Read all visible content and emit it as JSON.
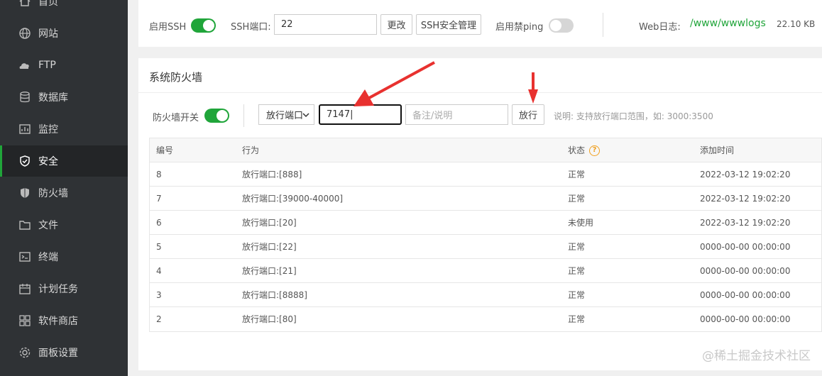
{
  "sidebar": {
    "items": [
      {
        "label": "首页",
        "icon": "home-icon"
      },
      {
        "label": "网站",
        "icon": "globe-icon"
      },
      {
        "label": "FTP",
        "icon": "ftp-icon"
      },
      {
        "label": "数据库",
        "icon": "database-icon"
      },
      {
        "label": "监控",
        "icon": "monitor-icon"
      },
      {
        "label": "安全",
        "icon": "shield-check-icon",
        "active": true
      },
      {
        "label": "防火墙",
        "icon": "shield-icon"
      },
      {
        "label": "文件",
        "icon": "folder-icon"
      },
      {
        "label": "终端",
        "icon": "terminal-icon"
      },
      {
        "label": "计划任务",
        "icon": "calendar-icon"
      },
      {
        "label": "软件商店",
        "icon": "grid-icon"
      },
      {
        "label": "面板设置",
        "icon": "gear-icon"
      }
    ]
  },
  "ssh": {
    "enable_label": "启用SSH",
    "enabled": true,
    "port_label": "SSH端口:",
    "port_value": "22",
    "change_button": "更改",
    "manage_button": "SSH安全管理",
    "ping_label": "启用禁ping",
    "ping_enabled": false,
    "weblog_label": "Web日志:",
    "weblog_path": "/www/wwwlogs",
    "weblog_size": "22.10 KB"
  },
  "firewall": {
    "title": "系统防火墙",
    "switch_label": "防火墙开关",
    "switch_on": true,
    "type_select": "放行端口",
    "port_input": "7147",
    "remark_placeholder": "备注/说明",
    "allow_button": "放行",
    "hint": "说明: 支持放行端口范围，如: 3000:3500",
    "columns": [
      "编号",
      "行为",
      "状态",
      "添加时间"
    ],
    "rows": [
      {
        "id": "8",
        "action": "放行端口:[888]",
        "status": "正常",
        "time": "2022-03-12 19:02:20"
      },
      {
        "id": "7",
        "action": "放行端口:[39000-40000]",
        "status": "正常",
        "time": "2022-03-12 19:02:20"
      },
      {
        "id": "6",
        "action": "放行端口:[20]",
        "status": "未使用",
        "time": "2022-03-12 19:02:20"
      },
      {
        "id": "5",
        "action": "放行端口:[22]",
        "status": "正常",
        "time": "0000-00-00 00:00:00"
      },
      {
        "id": "4",
        "action": "放行端口:[21]",
        "status": "正常",
        "time": "0000-00-00 00:00:00"
      },
      {
        "id": "3",
        "action": "放行端口:[8888]",
        "status": "正常",
        "time": "0000-00-00 00:00:00"
      },
      {
        "id": "2",
        "action": "放行端口:[80]",
        "status": "正常",
        "time": "0000-00-00 00:00:00"
      }
    ]
  },
  "colors": {
    "accent": "#20a53a",
    "arrow": "#e8312f",
    "sidebar": "#2f3235"
  },
  "watermark": "@稀土掘金技术社区"
}
